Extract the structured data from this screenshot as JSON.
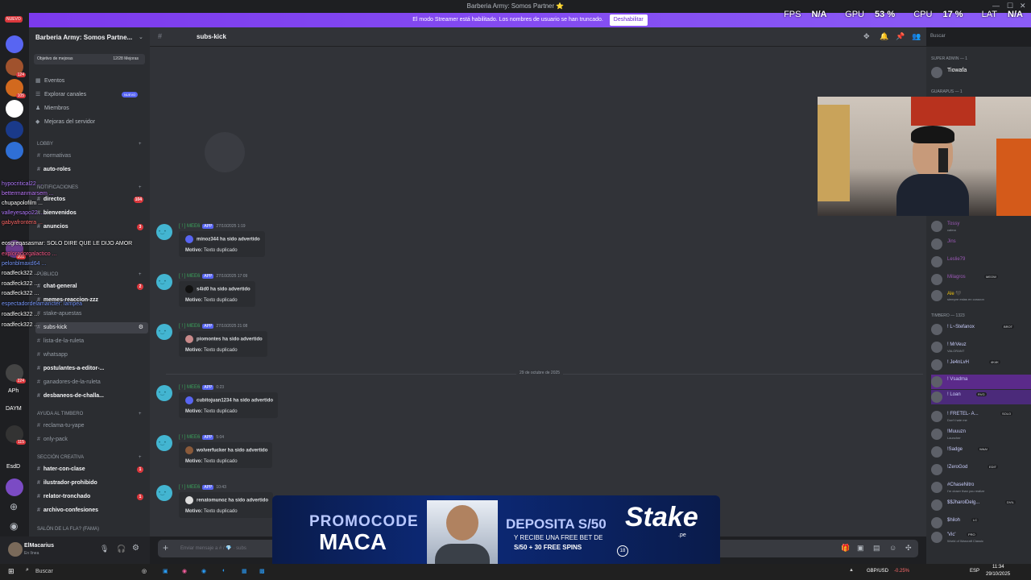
{
  "window": {
    "title": "Barberia Army: Somos Partner ⭐"
  },
  "streamer_bar": {
    "text": "El modo Streamer está habilitado. Los nombres de usuario se han truncado.",
    "button": "Deshabilitar"
  },
  "stats": {
    "fps_label": "FPS",
    "fps": "N/A",
    "gpu_label": "GPU",
    "gpu": "53 %",
    "cpu_label": "CPU",
    "cpu": "17 %",
    "lat_label": "LAT",
    "lat": "N/A"
  },
  "rail": {
    "new_badge": "NUEVO",
    "badges": [
      "124",
      "105",
      "201",
      "224",
      "115"
    ],
    "labels": [
      "APh",
      "DAYM",
      "EsdD",
      "CoC"
    ]
  },
  "sidebar": {
    "server_name": "Barberia Army: Somos Partne...",
    "boost_label": "Objetivo de mejoras",
    "boost_count": "12/28 Mejoras",
    "nav": [
      {
        "label": "Eventos",
        "icon": "📅"
      },
      {
        "label": "Explorar canales",
        "icon": "☰",
        "badge": "NUEVO"
      },
      {
        "label": "Miembros",
        "icon": "👥"
      },
      {
        "label": "Mejoras del servidor",
        "icon": "◆"
      }
    ],
    "categories": [
      "LOBBY",
      "NOTIFICACIONES",
      "PÚBLICO",
      "AYUDA AL TIMBERO",
      "SECCIÓN CREATIVA",
      "SALÓN DE LA FLA? (FAMA)"
    ],
    "channels": [
      {
        "name": "normativas"
      },
      {
        "name": "auto-roles",
        "bold": true
      },
      {
        "name": "directos",
        "bold": true,
        "count": "104"
      },
      {
        "name": "bienvenidos",
        "bold": true
      },
      {
        "name": "anuncios",
        "bold": true,
        "count": "3"
      },
      {
        "name": "chat-general",
        "bold": true,
        "count": "2"
      },
      {
        "name": "memes-reaccion-zzz",
        "bold": true
      },
      {
        "name": "stake-apuestas"
      },
      {
        "name": "subs-kick",
        "selected": true
      },
      {
        "name": "lista-de-la-ruleta"
      },
      {
        "name": "whatsapp"
      },
      {
        "name": "postulantes-a-editor-...",
        "bold": true
      },
      {
        "name": "ganadores-de-la-ruleta"
      },
      {
        "name": "desbaneos-de-challa...",
        "bold": true
      },
      {
        "name": "reclama-tu-yape"
      },
      {
        "name": "only-pack"
      },
      {
        "name": "hater-con-clase",
        "bold": true,
        "count": "1"
      },
      {
        "name": "ilustrador-prohibido",
        "bold": true
      },
      {
        "name": "relator-tronchado",
        "bold": true,
        "count": "1"
      },
      {
        "name": "archivo-confesiones",
        "bold": true
      }
    ]
  },
  "user": {
    "name": "ElMacarius",
    "status": "En línea"
  },
  "header": {
    "channel": "subs-kick",
    "search_placeholder": "Buscar"
  },
  "messages": [
    {
      "author": "[ ! ] MEE6",
      "app": "APP",
      "time": "27/10/2025 1:19",
      "title": "minoz344 ha sido advertido",
      "reason_label": "Motivo:",
      "reason": "Texto duplicado"
    },
    {
      "author": "[ ! ] MEE6",
      "app": "APP",
      "time": "27/10/2025 17:09",
      "title": "s4id0 ha sido advertido",
      "reason_label": "Motivo:",
      "reason": "Texto duplicado"
    },
    {
      "author": "[ ! ] MEE6",
      "app": "APP",
      "time": "27/10/2025 21:08",
      "title": "piomontes ha sido advertido",
      "reason_label": "Motivo:",
      "reason": "Texto duplicado"
    },
    {
      "author": "[ ! ] MEE6",
      "app": "APP",
      "time": "0:23",
      "title": "cubitojuan1234 ha sido advertido",
      "reason_label": "Motivo:",
      "reason": "Texto duplicado"
    },
    {
      "author": "[ ! ] MEE6",
      "app": "APP",
      "time": "5:04",
      "title": "wolverfucker ha sido advertido",
      "reason_label": "Motivo:",
      "reason": "Texto duplicado"
    },
    {
      "author": "[ ! ] MEE6",
      "app": "APP",
      "time": "10:43",
      "title": "renatomunoz ha sido advertido",
      "reason_label": "Motivo:",
      "reason": "Texto duplicado"
    }
  ],
  "date_divider": "29 de octubre de 2025",
  "composer": {
    "placeholder": "Enviar mensaje a # / 💎 · subs"
  },
  "members": {
    "cat1": "SUPER ADMIN — 1",
    "cat2": "GUARAPUS — 1",
    "cat3": "TIMBERO — 1323",
    "top": [
      {
        "name": "Tiowafa"
      }
    ],
    "list_a": [
      {
        "name": "Tossy",
        "sub": "calma"
      },
      {
        "name": "Jins",
        "sub": ""
      },
      {
        "name": "Leslie79",
        "sub": ""
      },
      {
        "name": "Milagros",
        "sub": "",
        "tag": "MEOW"
      },
      {
        "name": "Ale 🖤",
        "sub": "siempre estas en corazon"
      }
    ],
    "list_b": [
      {
        "name": "! L~Stefanox",
        "tag": "BROT"
      },
      {
        "name": "! MrVeuz",
        "sub": "VALORANT"
      },
      {
        "name": "! Je4nLvH",
        "tag": "4K4K"
      },
      {
        "name": "! Vsadma",
        "sub": ""
      },
      {
        "name": "! Loan",
        "tag": "RVG"
      },
      {
        "name": "! FRETEL- A...",
        "sub": "Don't hate me",
        "tag": "SOLO"
      },
      {
        "name": "!Muuuzn",
        "sub": "Launcher"
      },
      {
        "name": "!Sadge",
        "tag": "WAA!"
      },
      {
        "name": "!ZeroGod",
        "tag": "EDIT"
      },
      {
        "name": "#ChaseNitro",
        "sub": "I'm closer than you realize"
      },
      {
        "name": "$$JharolDelg...",
        "tag": "DVIL"
      },
      {
        "name": "$hiloh",
        "tag": "LC"
      },
      {
        "name": "'Vic'",
        "sub": "World of Warcraft Classic",
        "tag": "PRO"
      }
    ]
  },
  "overlay_chat": [
    "hypocritical22 ...",
    "bettermanmarsem ...",
    "chupapolofilm ...",
    "valleyesapo22 ...",
    "gabyafrontera ...",
    "eosgreqasasmar: SOLO DIRE QUE LE DIJO AMOR",
    "exploradorgalactico ...",
    "pelonblmaxd64 ...",
    "roadfeck322 ...",
    "roadfeck322 ...",
    "roadfeck322 ...",
    "espectadordelamancter: lampea",
    "roadfeck322 ...",
    "roadfeck322 ..."
  ],
  "banner": {
    "promo": "PROMOCODE",
    "code": "MACA",
    "deposit": "DEPOSITA S/50",
    "line2": "Y RECIBE UNA FREE BET DE",
    "line3": "S/50 + 30 FREE SPINS",
    "brand": "Stake",
    "brand_sub": ".pe",
    "age": "18"
  },
  "taskbar": {
    "search": "Buscar",
    "fx": "GBP/USD",
    "fx_change": "-0.25%",
    "lang": "ESP",
    "time": "11:34",
    "date": "29/10/2025"
  }
}
